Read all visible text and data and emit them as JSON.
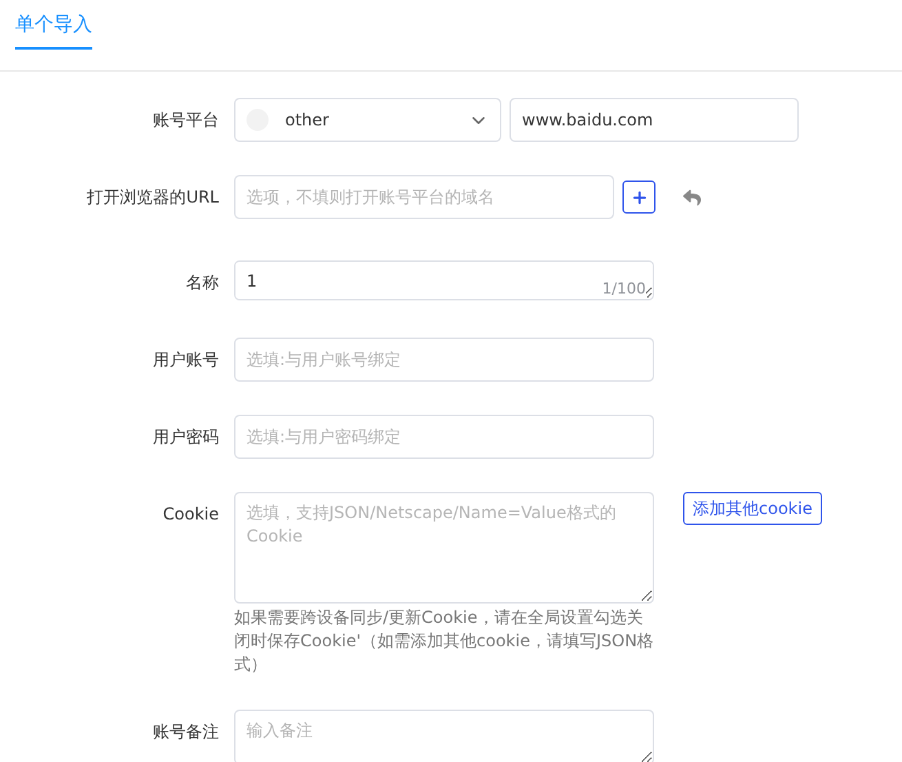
{
  "tabs": [
    {
      "label": "单个导入",
      "selected": true
    }
  ],
  "fields": [
    {
      "kind": "platform",
      "label": "账号平台",
      "option": "other",
      "value": "www.baidu.com"
    },
    {
      "kind": "url",
      "label": "打开浏览器的URL",
      "placeholder": "选项，不填则打开账号平台的域名"
    },
    {
      "kind": "counted",
      "label": "名称",
      "value": "1",
      "counter": "1/100"
    },
    {
      "kind": "input",
      "label": "用户账号",
      "placeholder": "选填:与用户账号绑定"
    },
    {
      "kind": "input",
      "label": "用户密码",
      "placeholder": "选填:与用户密码绑定"
    },
    {
      "kind": "cookie",
      "label": "Cookie",
      "placeholder": "选填，支持JSON/Netscape/Name=Value格式的Cookie",
      "button": "添加其他cookie",
      "help": "如果需要跨设备同步/更新Cookie，请在全局设置勾选关闭时保存Cookie'（如需添加其他cookie，请填写JSON格式）"
    },
    {
      "kind": "textarea",
      "label": "账号备注",
      "placeholder": "输入备注"
    }
  ]
}
